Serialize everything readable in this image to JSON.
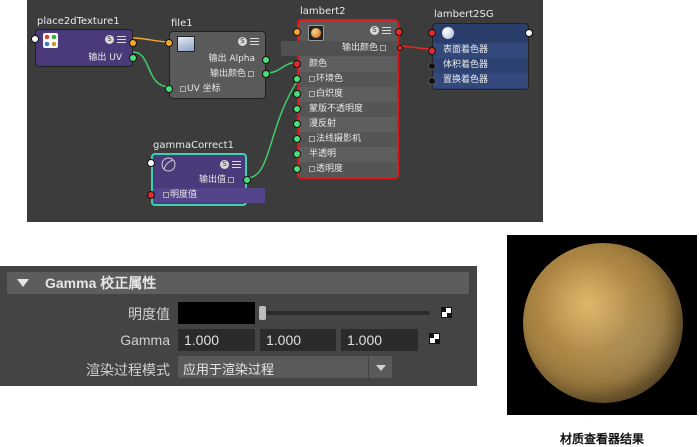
{
  "node_editor": {
    "place2d": {
      "title": "place2dTexture1",
      "output_uv": "输出 UV"
    },
    "file": {
      "title": "file1",
      "output_alpha": "输出 Alpha",
      "output_color": "输出颜色",
      "uv_coord": "UV 坐标"
    },
    "lambert": {
      "title": "lambert2",
      "output_color": "输出颜色",
      "attributes": [
        "颜色",
        "环境色",
        "白炽度",
        "蒙版不透明度",
        "漫反射",
        "法线摄影机",
        "半透明",
        "透明度"
      ]
    },
    "shading_group": {
      "title": "lambert2SG",
      "shaders": [
        "表面着色器",
        "体积着色器",
        "置换着色器"
      ]
    },
    "gamma": {
      "title": "gammaCorrect1",
      "output_value": "输出值",
      "value": "明度值"
    }
  },
  "attr_panel": {
    "section_title": "Gamma 校正属性",
    "value_label": "明度值",
    "gamma_label": "Gamma",
    "gamma_values": [
      "1.000",
      "1.000",
      "1.000"
    ],
    "render_mode_label": "渲染过程模式",
    "render_mode_value": "应用于渲染过程"
  },
  "viewer": {
    "caption": "材质查看器结果"
  },
  "colors": {
    "node_purple": "#4a3a7a",
    "node_gray": "#5a5a5a",
    "lambert_border": "#e01818",
    "gamma_border": "#3fd0b0",
    "sg_blue": "#2b3d6b",
    "wire_green": "#3fcf6a",
    "wire_orange": "#f5a623",
    "wire_red": "#e02a2a"
  }
}
